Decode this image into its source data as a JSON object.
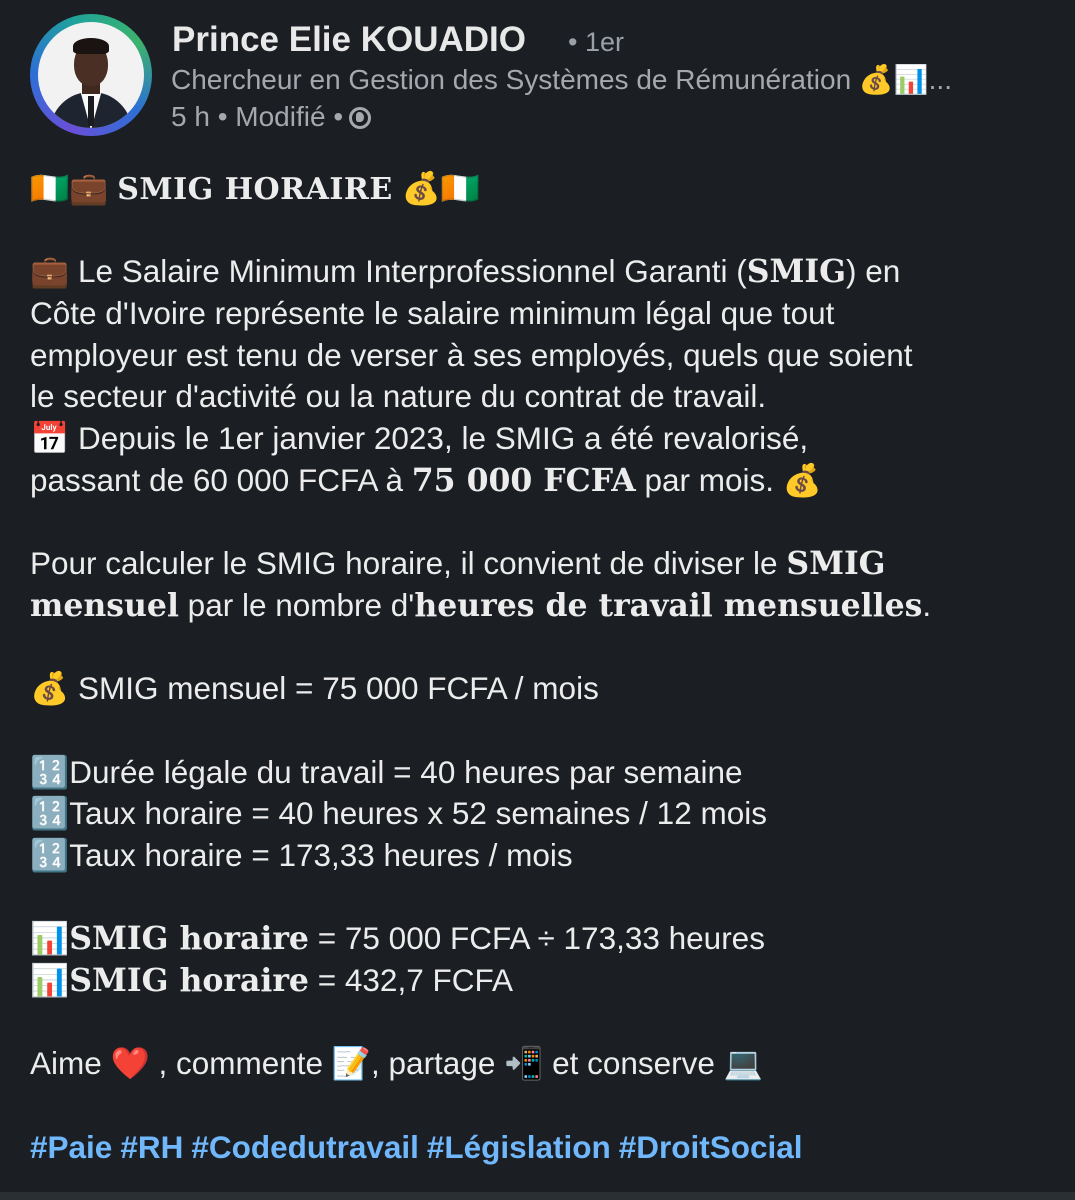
{
  "author": {
    "name": "Prince Elie KOUADIO",
    "degree": "• 1er",
    "headline": "Chercheur en Gestion des Systèmes de Rémunération 💰📊...",
    "meta": "5 h • Modifié •",
    "visibility_icon": "globe-icon"
  },
  "post": {
    "title_prefix": "🇨🇮💼",
    "title": "SMIG HORAIRE",
    "title_suffix": "💰🇨🇮",
    "p1_l1_a": "💼 Le Salaire Minimum Interprofessionnel Garanti (",
    "p1_l1_b": "SMIG",
    "p1_l1_c": ") en",
    "p1_l2": "Côte d'Ivoire représente le salaire minimum légal que tout",
    "p1_l3": "employeur est tenu de verser à ses employés, quels que soient",
    "p1_l4": "le secteur d'activité ou la nature du contrat de travail.",
    "p1_l5": "📅 Depuis le 1er janvier 2023, le SMIG a été revalorisé,",
    "p1_l6_a": "passant de 60 000 FCFA à ",
    "p1_l6_b": "75 000 FCFA",
    "p1_l6_c": " par mois. 💰",
    "p2_l1_a": "Pour calculer le SMIG horaire, il convient de diviser le ",
    "p2_l1_b": "SMIG",
    "p2_l2_a": "mensuel",
    "p2_l2_b": " par le nombre d'",
    "p2_l2_c": "heures de travail mensuelles",
    "p2_l2_d": ".",
    "p3": "💰  SMIG mensuel = 75 000 FCFA / mois",
    "p4_l1": "🔢Durée légale du travail = 40 heures par semaine",
    "p4_l2": "🔢Taux horaire = 40 heures x 52 semaines / 12 mois",
    "p4_l3": "🔢Taux horaire = 173,33 heures / mois",
    "p5_l1_icon": "📊",
    "p5_l1_bold": "SMIG horaire",
    "p5_l1_rest": " = 75 000 FCFA ÷ 173,33 heures",
    "p5_l2_icon": "📊",
    "p5_l2_bold": "SMIG horaire",
    "p5_l2_rest": " = 432,7 FCFA",
    "cta": "Aime ❤️ , commente 📝, partage 📲 et conserve 💻",
    "hashtags": [
      "#Paie",
      "#RH",
      "#Codedutravail",
      "#Législation",
      "#DroitSocial"
    ]
  },
  "colors": {
    "background": "#1b1f23",
    "text": "#ececec",
    "muted": "#a5a9ae",
    "hashtag": "#71b7fb"
  }
}
